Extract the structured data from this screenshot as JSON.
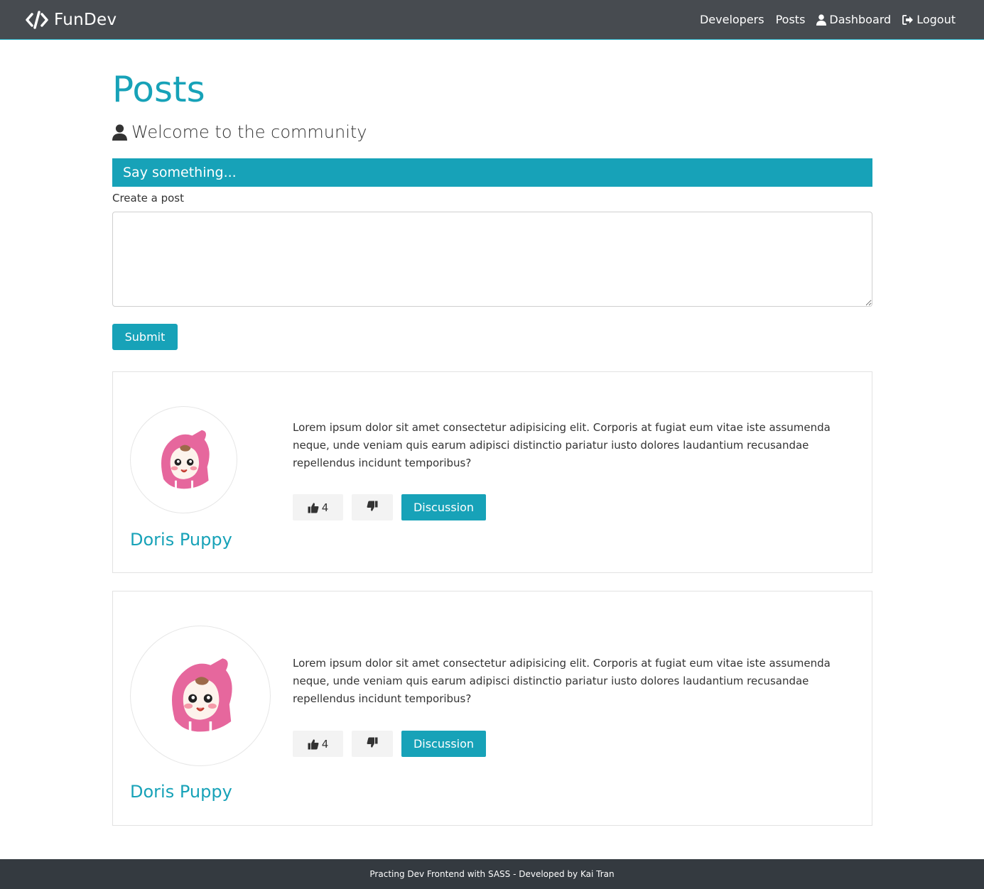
{
  "navbar": {
    "brand": "FunDev",
    "links": [
      {
        "label": "Developers",
        "icon": ""
      },
      {
        "label": "Posts",
        "icon": ""
      },
      {
        "label": "Dashboard",
        "icon": "user-icon"
      },
      {
        "label": "Logout",
        "icon": "sign-out-icon"
      }
    ]
  },
  "page": {
    "title": "Posts",
    "lead": "Welcome to the community"
  },
  "post_form": {
    "header": "Say something...",
    "label": "Create a post",
    "textarea_value": "",
    "submit_label": "Submit"
  },
  "posts": [
    {
      "author": "Doris Puppy",
      "text": "Lorem ipsum dolor sit amet consectetur adipisicing elit. Corporis at fugiat eum vitae iste assumenda neque, unde veniam quis earum adipisci distinctio pariatur iusto dolores laudantium recusandae repellendus incidunt temporibus?",
      "likes": "4",
      "discussion_label": "Discussion"
    },
    {
      "author": "Doris Puppy",
      "text": "Lorem ipsum dolor sit amet consectetur adipisicing elit. Corporis at fugiat eum vitae iste assumenda neque, unde veniam quis earum adipisci distinctio pariatur iusto dolores laudantium recusandae repellendus incidunt temporibus?",
      "likes": "4",
      "discussion_label": "Discussion"
    }
  ],
  "footer": {
    "text": "Practing Dev Frontend with SASS - Developed by Kai Tran"
  },
  "colors": {
    "accent": "#17a2b8",
    "navbar": "#474b50",
    "footer": "#343a40"
  }
}
